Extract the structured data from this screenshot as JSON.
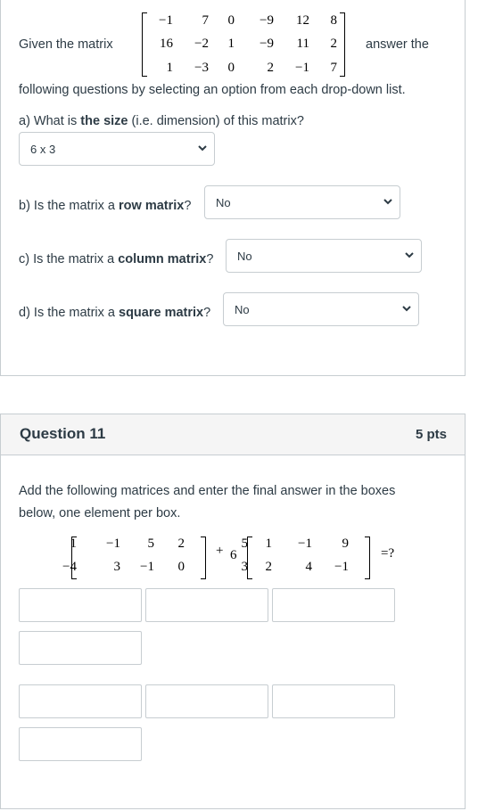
{
  "q10": {
    "intro_before": "Given the matrix",
    "intro_after": "answer the",
    "intro_line2": "following questions by selecting an option from each drop-down list.",
    "matrix": [
      [
        "−1",
        "7",
        "0",
        "−9",
        "12",
        "8"
      ],
      [
        "16",
        "−2",
        "1",
        "−9",
        "11",
        "2"
      ],
      [
        "1",
        "−3",
        "0",
        "2",
        "−1",
        "7"
      ]
    ],
    "part_a": {
      "prefix": "a) What is ",
      "bold": "the size",
      "suffix": " (i.e. dimension) of this matrix?",
      "selected": "6 x 3"
    },
    "part_b": {
      "prefix": "b) Is the matrix a ",
      "bold": "row matrix",
      "suffix": "?",
      "selected": "No"
    },
    "part_c": {
      "prefix": "c) Is the matrix a ",
      "bold": "column matrix",
      "suffix": "?",
      "selected": "No"
    },
    "part_d": {
      "prefix": "d) Is the matrix a ",
      "bold": "square matrix",
      "suffix": "?",
      "selected": "No"
    }
  },
  "q11": {
    "title": "Question 11",
    "points": "5 pts",
    "instructions_line1": "Add the following matrices and enter the final answer in the boxes",
    "instructions_line2": "below, one element per box.",
    "matrix_a": [
      [
        "1",
        "−1",
        "5",
        "2"
      ],
      [
        "−4",
        "3",
        "−1",
        "0"
      ]
    ],
    "plus": "+",
    "scalar": "6",
    "matrix_b": [
      [
        "5",
        "1",
        "−1",
        "9"
      ],
      [
        "3",
        "2",
        "4",
        "−1"
      ]
    ],
    "equals": "=?"
  },
  "icons": {
    "dropdown": "chevron-down-icon"
  },
  "colors": {
    "border": "#c7cdd1",
    "header_bg": "#f5f5f5",
    "text": "#2d3b45"
  }
}
